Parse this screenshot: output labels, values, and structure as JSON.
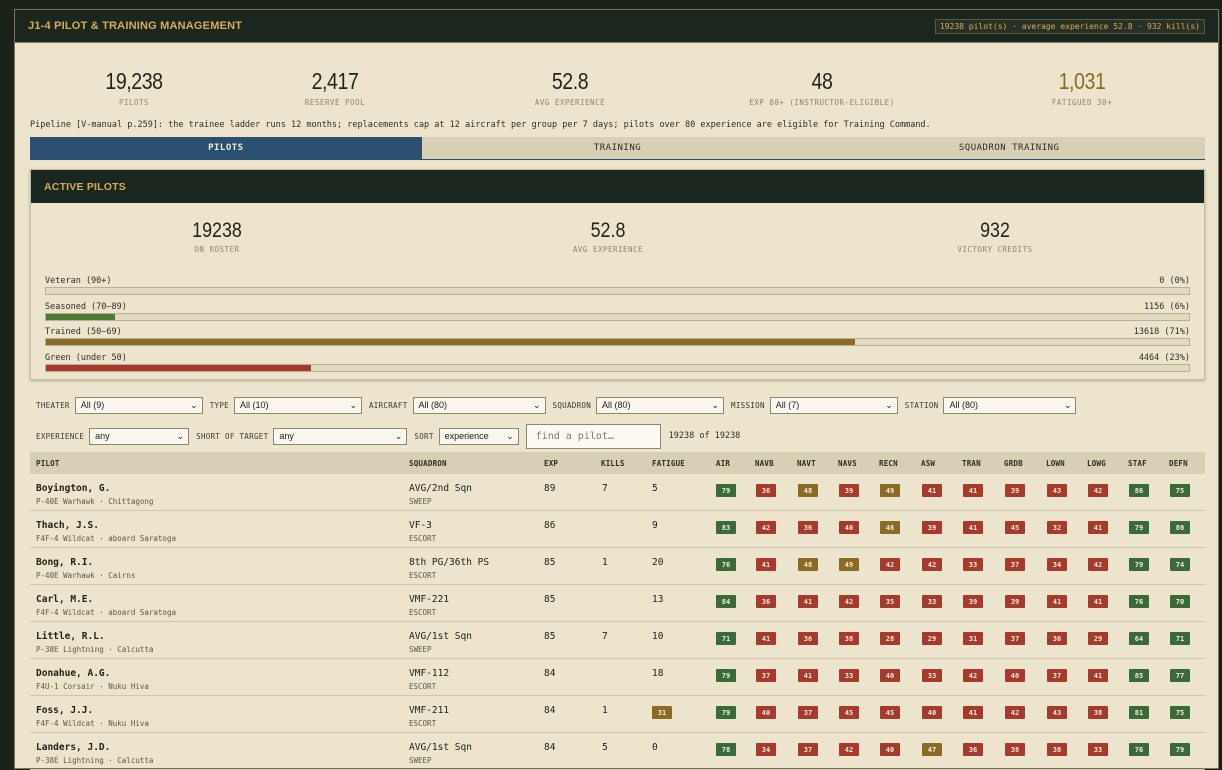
{
  "header": {
    "title": "J1-4 PILOT & TRAINING MANAGEMENT",
    "status": "19238 pilot(s) · average experience 52.8 · 932 kill(s)"
  },
  "kpis": [
    {
      "value": "19,238",
      "label": "PILOTS",
      "color": "#24231c"
    },
    {
      "value": "2,417",
      "label": "RESERVE POOL",
      "color": "#24231c"
    },
    {
      "value": "52.8",
      "label": "AVG EXPERIENCE",
      "color": "#24231c"
    },
    {
      "value": "48",
      "label": "EXP 80+ (INSTRUCTOR-ELIGIBLE)",
      "color": "#24231c"
    },
    {
      "value": "1,031",
      "label": "FATIGUED 30+",
      "color": "#8a6a24"
    }
  ],
  "pipeline_note": "Pipeline [V-manual p.259]: the trainee ladder runs 12 months; replacements cap at 12 aircraft per group per 7 days; pilots over 80 experience are eligible for Training Command.",
  "tabs": [
    {
      "label": "PILOTS",
      "active": true
    },
    {
      "label": "TRAINING",
      "active": false
    },
    {
      "label": "SQUADRON TRAINING",
      "active": false
    }
  ],
  "active_pilots": {
    "title": "ACTIVE PILOTS",
    "stats": [
      {
        "value": "19238",
        "label": "ON ROSTER"
      },
      {
        "value": "52.8",
        "label": "AVG EXPERIENCE"
      },
      {
        "value": "932",
        "label": "VICTORY CREDITS"
      }
    ],
    "bars": [
      {
        "label": "Veteran (90+)",
        "value": "0 (0%)",
        "fraction": 0.0,
        "color": "#3a6a3a"
      },
      {
        "label": "Seasoned (70–89)",
        "value": "1156 (6%)",
        "fraction": 0.06,
        "color": "#4a7a36"
      },
      {
        "label": "Trained (50–69)",
        "value": "13618 (71%)",
        "fraction": 0.708,
        "color": "#8a6a24"
      },
      {
        "label": "Green (under 50)",
        "value": "4464 (23%)",
        "fraction": 0.232,
        "color": "#a8392d"
      }
    ]
  },
  "filters": {
    "row1": [
      {
        "label": "THEATER",
        "value": "All (9)"
      },
      {
        "label": "TYPE",
        "value": "All (10)"
      },
      {
        "label": "AIRCRAFT",
        "value": "All (80)"
      },
      {
        "label": "SQUADRON",
        "value": "All (80)"
      },
      {
        "label": "MISSION",
        "value": "All (7)"
      },
      {
        "label": "STATION",
        "value": "All (80)"
      }
    ],
    "row2": [
      {
        "label": "EXPERIENCE",
        "value": "any"
      },
      {
        "label": "SHORT OF TARGET",
        "value": "any"
      },
      {
        "label": "SORT",
        "value": "experience"
      }
    ],
    "search_placeholder": "find a pilot…",
    "count": "19238 of 19238"
  },
  "table": {
    "headers": [
      "PILOT",
      "SQUADRON",
      "EXP",
      "KILLS",
      "FATIGUE",
      "AIR",
      "NAVB",
      "NAVT",
      "NAVS",
      "RECN",
      "ASW",
      "TRAN",
      "GRDB",
      "LOWN",
      "LOWG",
      "STAF",
      "DEFN"
    ],
    "rows": [
      {
        "name": "Boyington, G.",
        "aircraft": "P-40E Warhawk · Chittagong",
        "squadron": "AVG/2nd Sqn",
        "mission": "SWEEP",
        "exp": "89",
        "kills": "7",
        "fatigue": "5",
        "fatigue_hot": false,
        "skills": [
          79,
          36,
          48,
          39,
          49,
          41,
          41,
          39,
          43,
          42,
          86,
          75
        ]
      },
      {
        "name": "Thach, J.S.",
        "aircraft": "F4F-4 Wildcat · aboard Saratoga",
        "squadron": "VF-3",
        "mission": "ESCORT",
        "exp": "86",
        "kills": "",
        "fatigue": "9",
        "fatigue_hot": false,
        "skills": [
          83,
          42,
          36,
          40,
          46,
          39,
          41,
          45,
          32,
          41,
          79,
          80
        ]
      },
      {
        "name": "Bong, R.I.",
        "aircraft": "P-40E Warhawk · Cairns",
        "squadron": "8th PG/36th PS",
        "mission": "ESCORT",
        "exp": "85",
        "kills": "1",
        "fatigue": "20",
        "fatigue_hot": false,
        "skills": [
          76,
          41,
          48,
          49,
          42,
          42,
          33,
          37,
          34,
          42,
          79,
          74
        ]
      },
      {
        "name": "Carl, M.E.",
        "aircraft": "F4F-4 Wildcat · aboard Saratoga",
        "squadron": "VMF-221",
        "mission": "ESCORT",
        "exp": "85",
        "kills": "",
        "fatigue": "13",
        "fatigue_hot": false,
        "skills": [
          84,
          36,
          41,
          42,
          35,
          33,
          39,
          39,
          41,
          41,
          76,
          70
        ]
      },
      {
        "name": "Little, R.L.",
        "aircraft": "P-38E Lightning · Calcutta",
        "squadron": "AVG/1st Sqn",
        "mission": "SWEEP",
        "exp": "85",
        "kills": "7",
        "fatigue": "10",
        "fatigue_hot": false,
        "skills": [
          71,
          41,
          36,
          38,
          28,
          29,
          31,
          37,
          36,
          29,
          64,
          71
        ]
      },
      {
        "name": "Donahue, A.G.",
        "aircraft": "F4U-1 Corsair · Nuku Hiva",
        "squadron": "VMF-112",
        "mission": "ESCORT",
        "exp": "84",
        "kills": "",
        "fatigue": "18",
        "fatigue_hot": false,
        "skills": [
          79,
          37,
          41,
          33,
          40,
          33,
          42,
          40,
          37,
          41,
          85,
          77
        ]
      },
      {
        "name": "Foss, J.J.",
        "aircraft": "F4F-4 Wildcat · Nuku Hiva",
        "squadron": "VMF-211",
        "mission": "ESCORT",
        "exp": "84",
        "kills": "1",
        "fatigue": "31",
        "fatigue_hot": true,
        "skills": [
          79,
          40,
          37,
          45,
          45,
          40,
          41,
          42,
          43,
          38,
          81,
          75
        ]
      },
      {
        "name": "Landers, J.D.",
        "aircraft": "P-38E Lightning · Calcutta",
        "squadron": "AVG/1st Sqn",
        "mission": "SWEEP",
        "exp": "84",
        "kills": "5",
        "fatigue": "0",
        "fatigue_hot": false,
        "skills": [
          78,
          34,
          37,
          42,
          40,
          47,
          36,
          38,
          38,
          33,
          76,
          79
        ]
      }
    ]
  },
  "colors": {
    "good": "#3a6a3a",
    "bad": "#a8392d",
    "mid": "#8a6a24",
    "accent": "#d6ac5a",
    "tab_active": "#2b506f"
  }
}
